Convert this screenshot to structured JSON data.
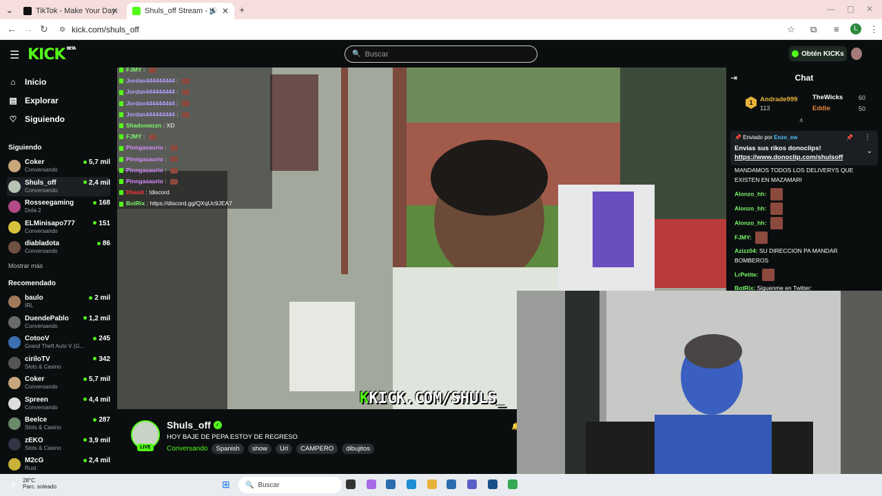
{
  "browser": {
    "tabs": [
      {
        "title": "TikTok - Make Your Day"
      },
      {
        "title": "Shuls_off Stream - Watch Li"
      }
    ],
    "url": "kick.com/shuls_off",
    "profile_initial": "L"
  },
  "header": {
    "logo": "KICK",
    "logo_badge": "BETA",
    "search_placeholder": "Buscar",
    "kicks_button": "Obtén KICKs"
  },
  "sidebar": {
    "nav": [
      {
        "label": "Inicio",
        "icon": "home-icon"
      },
      {
        "label": "Explorar",
        "icon": "explore-icon"
      },
      {
        "label": "Siguiendo",
        "icon": "heart-icon"
      }
    ],
    "following_title": "Siguiendo",
    "following": [
      {
        "name": "Coker",
        "sub": "Conversando",
        "viewers": "5,7 mil",
        "color": "#c9a77c"
      },
      {
        "name": "Shuls_off",
        "sub": "Conversando",
        "viewers": "2,4 mil",
        "color": "#b7c3b5"
      },
      {
        "name": "Rosseegaming",
        "sub": "Dota 2",
        "viewers": "168",
        "color": "#b44a87"
      },
      {
        "name": "ELMinisapo777",
        "sub": "Conversando",
        "viewers": "151",
        "color": "#d6c23d"
      },
      {
        "name": "diabladota",
        "sub": "Conversando",
        "viewers": "86",
        "color": "#705040"
      }
    ],
    "show_more": "Mostrar más",
    "recommended_title": "Recomendado",
    "recommended": [
      {
        "name": "baulo",
        "sub": "IRL",
        "viewers": "2 mil",
        "color": "#a07a5a"
      },
      {
        "name": "DuendePablo",
        "sub": "Conversando",
        "viewers": "1,2 mil",
        "color": "#6a6a6a"
      },
      {
        "name": "CotooV",
        "sub": "Grand Theft Auto V (G...",
        "viewers": "245",
        "color": "#3a6fb0"
      },
      {
        "name": "ciriloTV",
        "sub": "Slots & Casino",
        "viewers": "342",
        "color": "#555"
      },
      {
        "name": "Coker",
        "sub": "Conversando",
        "viewers": "5,7 mil",
        "color": "#c9a77c"
      },
      {
        "name": "Spreen",
        "sub": "Conversando",
        "viewers": "4,4 mil",
        "color": "#ddd"
      },
      {
        "name": "Beelce",
        "sub": "Slots & Casino",
        "viewers": "287",
        "color": "#6a8a6a"
      },
      {
        "name": "zEKO",
        "sub": "Slots & Casino",
        "viewers": "3,9 mil",
        "color": "#334"
      },
      {
        "name": "M2cG",
        "sub": "Rust",
        "viewers": "2,4 mil",
        "color": "#c9b13a"
      }
    ]
  },
  "overlay_chat": [
    {
      "user": "FJMY",
      "text": "",
      "emote": true,
      "color": "#7cf76c"
    },
    {
      "user": "Jordan444444444",
      "text": "",
      "emote": true,
      "color": "#b59cff"
    },
    {
      "user": "Jordan444444444",
      "text": "",
      "emote": true,
      "color": "#b59cff"
    },
    {
      "user": "Jordan444444444",
      "text": "",
      "emote": true,
      "color": "#b59cff"
    },
    {
      "user": "Jordan444444444",
      "text": "",
      "emote": true,
      "color": "#b59cff"
    },
    {
      "user": "Shadoowzzn",
      "text": "XD",
      "emote": false,
      "color": "#7cf76c"
    },
    {
      "user": "FJMY",
      "text": "",
      "emote": true,
      "color": "#7cf76c"
    },
    {
      "user": "Pinngasaurio",
      "text": "",
      "emote": true,
      "color": "#d58cff"
    },
    {
      "user": "Pinngasaurio",
      "text": "",
      "emote": true,
      "color": "#d58cff"
    },
    {
      "user": "Pinngasaurio",
      "text": "",
      "emote": true,
      "color": "#d58cff"
    },
    {
      "user": "Pinngasaurio",
      "text": "",
      "emote": true,
      "color": "#d58cff"
    },
    {
      "user": "Dhesit",
      "text": "!discord",
      "emote": false,
      "color": "#ff3a3a"
    },
    {
      "user": "BotRix",
      "text": "https://discord.gg/QXqUc9JEA7",
      "emote": false,
      "color": "#7cf76c"
    }
  ],
  "video_overlay_url": "KICK.COM/SHULS_",
  "stream": {
    "name": "Shuls_off",
    "live_badge": "LIVE",
    "title": "HOY BAJE DE PEPA ESTOY DE REGRESO",
    "category": "Conversando",
    "tags": [
      "Spanish",
      "show",
      "Url",
      "CAMPERO",
      "dibujitos"
    ]
  },
  "chat": {
    "title": "Chat",
    "leaderboard": {
      "rank1": {
        "rank": "1",
        "name": "Andrade999",
        "value": "113"
      },
      "rank2": {
        "name": "TheWicks",
        "value": "60"
      },
      "rank3": {
        "name": "Eddie",
        "value": "50"
      }
    },
    "pinned": {
      "prefix": "Enviado por",
      "by": "Enzo_sw",
      "text": "Envias sus rikos donoclips!",
      "link": "https://www.donoclip.com/shulsoff"
    },
    "messages": [
      {
        "user": "",
        "text": "MANDAMOS TODOS LOS DELIVERYS QUE EXISTEN EN MAZAMARI",
        "color": "#fff",
        "emote": false
      },
      {
        "user": "Alonzo_hh:",
        "text": "",
        "color": "#7cf76c",
        "emote": true
      },
      {
        "user": "Alonzo_hh:",
        "text": "",
        "color": "#7cf76c",
        "emote": true
      },
      {
        "user": "Alonzo_hh:",
        "text": "",
        "color": "#7cf76c",
        "emote": true
      },
      {
        "user": "FJMY:",
        "text": "",
        "color": "#7cf76c",
        "emote": true
      },
      {
        "user": "Azizz04:",
        "text": "SU DIRECCION PA MANDAR BOMBEROS",
        "color": "#7cf76c",
        "emote": false
      },
      {
        "user": "LrPetite:",
        "text": "",
        "color": "#7cf76c",
        "emote": true
      },
      {
        "user": "BotRix:",
        "text": "Siguenme en Twitter:",
        "color": "#7cf76c",
        "emote": false
      }
    ]
  },
  "taskbar": {
    "temp": "28°C",
    "condition": "Parc. soleado",
    "search": "Buscar"
  }
}
